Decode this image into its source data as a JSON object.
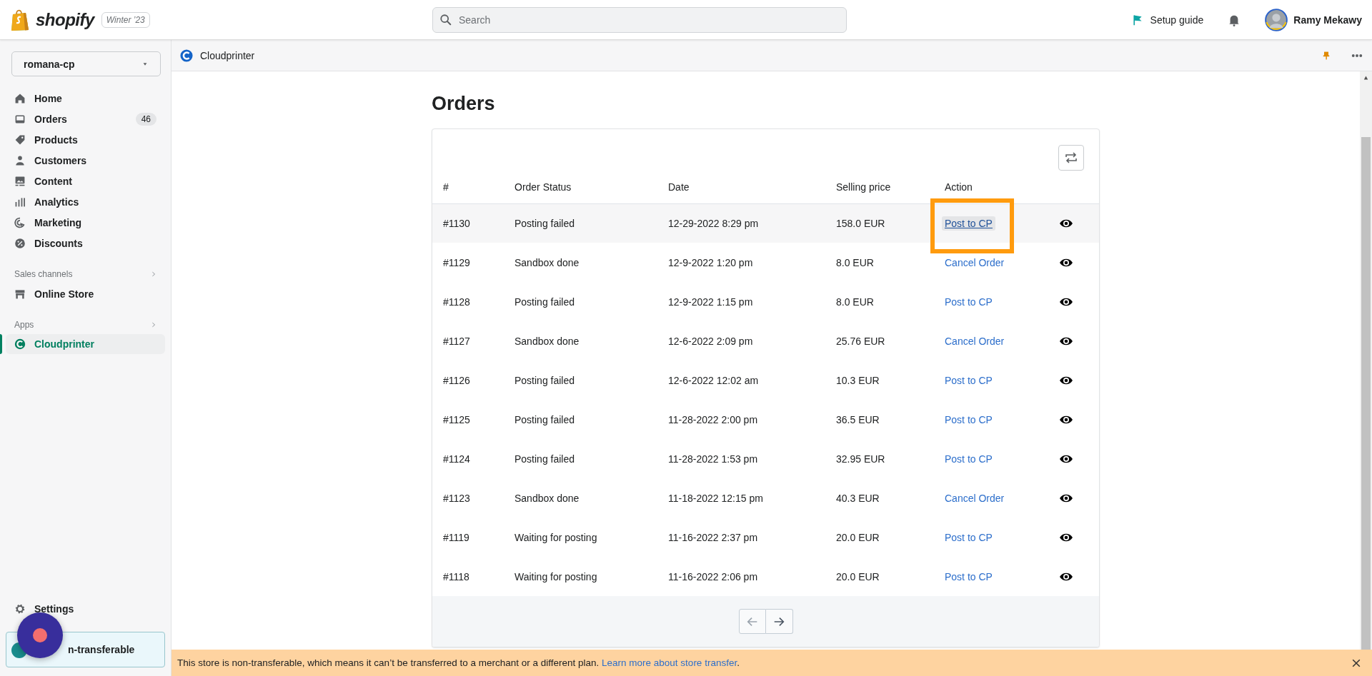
{
  "top_bar": {
    "logo": "shopify",
    "edition": "Winter ’23",
    "search": {
      "placeholder": "Search"
    },
    "setup_guide": "Setup guide",
    "user": "Ramy Mekawy"
  },
  "sidebar": {
    "store": "romana-cp",
    "items": [
      {
        "label": "Home",
        "selected": false
      },
      {
        "label": "Orders",
        "badge": "46",
        "selected": false
      },
      {
        "label": "Products",
        "selected": false
      },
      {
        "label": "Customers",
        "selected": false
      },
      {
        "label": "Content",
        "selected": false
      },
      {
        "label": "Analytics",
        "selected": false
      },
      {
        "label": "Marketing",
        "selected": false
      },
      {
        "label": "Discounts",
        "selected": false
      }
    ],
    "sections": [
      {
        "title": "Sales channels",
        "items": [
          {
            "label": "Online Store",
            "selected": false
          }
        ]
      },
      {
        "title": "Apps",
        "items": [
          {
            "label": "Cloudprinter",
            "selected": true
          }
        ]
      }
    ],
    "settings": "Settings",
    "store_notice": "n-transferable"
  },
  "app_header": {
    "title": "Cloudprinter"
  },
  "page": {
    "title": "Orders",
    "table": {
      "columns": [
        "#",
        "Order Status",
        "Date",
        "Selling price",
        "Action"
      ],
      "rows": [
        {
          "number": "#1130",
          "status": "Posting failed",
          "date": "12-29-2022 8:29 pm",
          "price": "158.0 EUR",
          "action": "Post to CP",
          "selected": true
        },
        {
          "number": "#1129",
          "status": "Sandbox done",
          "date": "12-9-2022 1:20 pm",
          "price": "8.0 EUR",
          "action": "Cancel Order",
          "selected": false
        },
        {
          "number": "#1128",
          "status": "Posting failed",
          "date": "12-9-2022 1:15 pm",
          "price": "8.0 EUR",
          "action": "Post to CP",
          "selected": false
        },
        {
          "number": "#1127",
          "status": "Sandbox done",
          "date": "12-6-2022 2:09 pm",
          "price": "25.76 EUR",
          "action": "Cancel Order",
          "selected": false
        },
        {
          "number": "#1126",
          "status": "Posting failed",
          "date": "12-6-2022 12:02 am",
          "price": "10.3 EUR",
          "action": "Post to CP",
          "selected": false
        },
        {
          "number": "#1125",
          "status": "Posting failed",
          "date": "11-28-2022 2:00 pm",
          "price": "36.5 EUR",
          "action": "Post to CP",
          "selected": false
        },
        {
          "number": "#1124",
          "status": "Posting failed",
          "date": "11-28-2022 1:53 pm",
          "price": "32.95 EUR",
          "action": "Post to CP",
          "selected": false
        },
        {
          "number": "#1123",
          "status": "Sandbox done",
          "date": "11-18-2022 12:15 pm",
          "price": "40.3 EUR",
          "action": "Cancel Order",
          "selected": false
        },
        {
          "number": "#1119",
          "status": "Waiting for posting",
          "date": "11-16-2022 2:37 pm",
          "price": "20.0 EUR",
          "action": "Post to CP",
          "selected": false
        },
        {
          "number": "#1118",
          "status": "Waiting for posting",
          "date": "11-16-2022 2:06 pm",
          "price": "20.0 EUR",
          "action": "Post to CP",
          "selected": false
        }
      ]
    },
    "pagination": {
      "previous": {
        "disabled": true
      },
      "next": {
        "disabled": false
      }
    }
  },
  "banner": {
    "text": "This store is non-transferable, which means it can’t be transferred to a merchant or a different plan.",
    "link": "Learn more about store transfer",
    "end": "."
  }
}
